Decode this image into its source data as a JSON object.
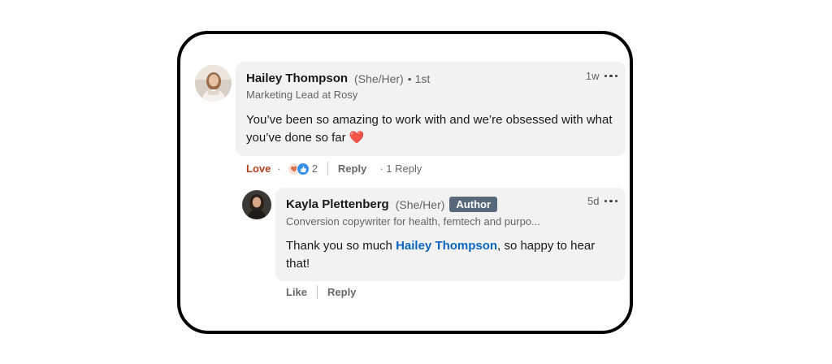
{
  "comment": {
    "author": "Hailey Thompson",
    "pronouns": "(She/Her)",
    "dot": "•",
    "degree": "1st",
    "headline": "Marketing Lead at Rosy",
    "time": "1w",
    "text": "You’ve been so amazing to work with and we’re obsessed with what you’ve done so far ❤️",
    "actions": {
      "love_label": "Love",
      "dot": "·",
      "reaction_count": "2",
      "reply_label": "Reply",
      "reply_count_label": "· 1 Reply"
    },
    "reaction_icons": [
      "love-reaction-icon",
      "like-reaction-icon"
    ]
  },
  "reply": {
    "author": "Kayla Plettenberg",
    "pronouns": "(She/Her)",
    "badge": "Author",
    "headline": "Conversion copywriter for health, femtech and purpo...",
    "time": "5d",
    "text_before": "Thank you so much ",
    "mention": "Hailey Thompson",
    "text_after": ", so happy to hear that!",
    "actions": {
      "like_label": "Like",
      "reply_label": "Reply"
    }
  },
  "colors": {
    "bubble": "#f2f2f2",
    "love": "#b24020",
    "mention": "#0a66c2",
    "badge": "#56687a"
  }
}
